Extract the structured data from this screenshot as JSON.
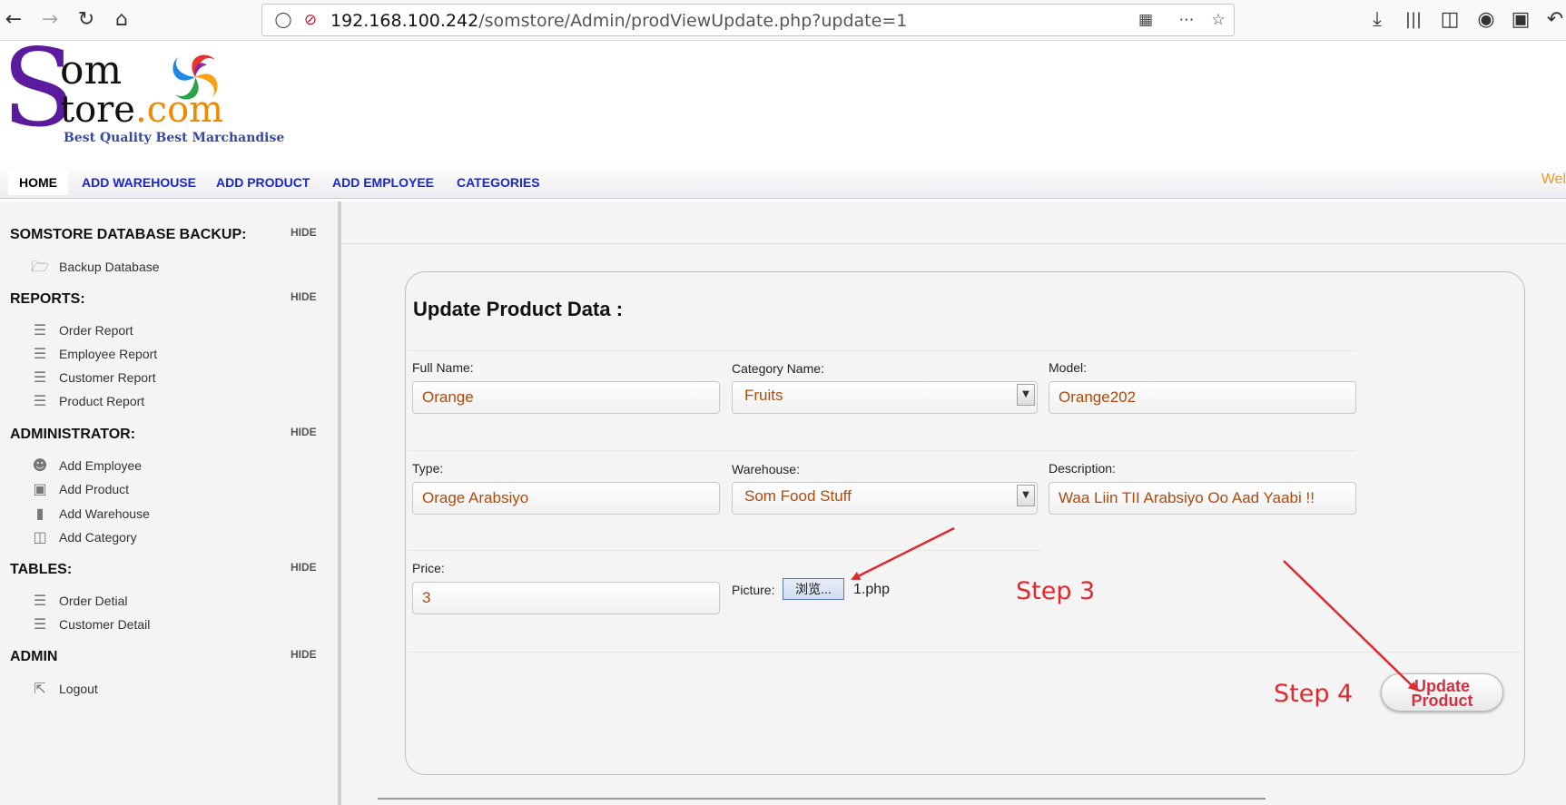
{
  "browser": {
    "url_host": "192.168.100.242",
    "url_path": "/somstore/Admin/prodViewUpdate.php?update=1"
  },
  "logo": {
    "s": "S",
    "om": "om",
    "tore": "tore",
    "com": ".com",
    "tagline": "Best Quality Best Marchandise"
  },
  "nav": {
    "items": [
      "HOME",
      "ADD WAREHOUSE",
      "ADD PRODUCT",
      "ADD EMPLOYEE",
      "CATEGORIES"
    ],
    "welcome": "Wel"
  },
  "sidebar": {
    "hide_label": "HIDE",
    "sections": [
      {
        "title": "SOMSTORE DATABASE BACKUP:",
        "items": [
          "Backup Database"
        ]
      },
      {
        "title": "REPORTS:",
        "items": [
          "Order Report",
          "Employee Report",
          "Customer Report",
          "Product Report"
        ]
      },
      {
        "title": "ADMINISTRATOR:",
        "items": [
          "Add Employee",
          "Add Product",
          "Add Warehouse",
          "Add Category"
        ]
      },
      {
        "title": "TABLES:",
        "items": [
          "Order Detial",
          "Customer Detail"
        ]
      },
      {
        "title": "ADMIN",
        "items": [
          "Logout"
        ]
      }
    ]
  },
  "form": {
    "title": "Update Product Data :",
    "full_name_label": "Full Name:",
    "full_name_value": "Orange",
    "category_label": "Category Name:",
    "category_value": "Fruits",
    "model_label": "Model:",
    "model_value": "Orange202",
    "type_label": "Type:",
    "type_value": "Orage Arabsiyo",
    "warehouse_label": "Warehouse:",
    "warehouse_value": "Som Food Stuff",
    "description_label": "Description:",
    "description_value": "Waa Liin TII Arabsiyo Oo Aad Yaabi !!",
    "price_label": "Price:",
    "price_value": "3",
    "picture_label": "Picture:",
    "browse_label": "浏览...",
    "file_name": "1.php",
    "update_label": "Update Product"
  },
  "annotations": {
    "step3": "Step 3",
    "step4": "Step 4",
    "arrow_color": "#e0282d"
  }
}
